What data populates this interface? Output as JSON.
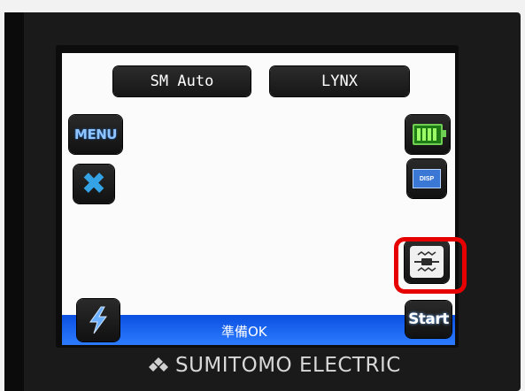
{
  "header": {
    "mode_left": "SM Auto",
    "mode_right": "LYNX"
  },
  "left_buttons": {
    "menu_label": "MENU",
    "cancel_icon": "x-icon",
    "arc_icon": "lightning-bolt-icon"
  },
  "right_buttons": {
    "battery_icon": "battery-icon",
    "display_label": "DISP",
    "splice_icon": "fiber-splice-icon",
    "start_label": "Start"
  },
  "status": {
    "text": "準備OK"
  },
  "brand": {
    "name": "SUMITOMO ELECTRIC"
  },
  "colors": {
    "status_bar": "#1f6cff",
    "highlight": "#e60000",
    "battery": "#6fcf52",
    "menu_text": "#8fc4ff",
    "x_icon": "#34a3e6"
  }
}
